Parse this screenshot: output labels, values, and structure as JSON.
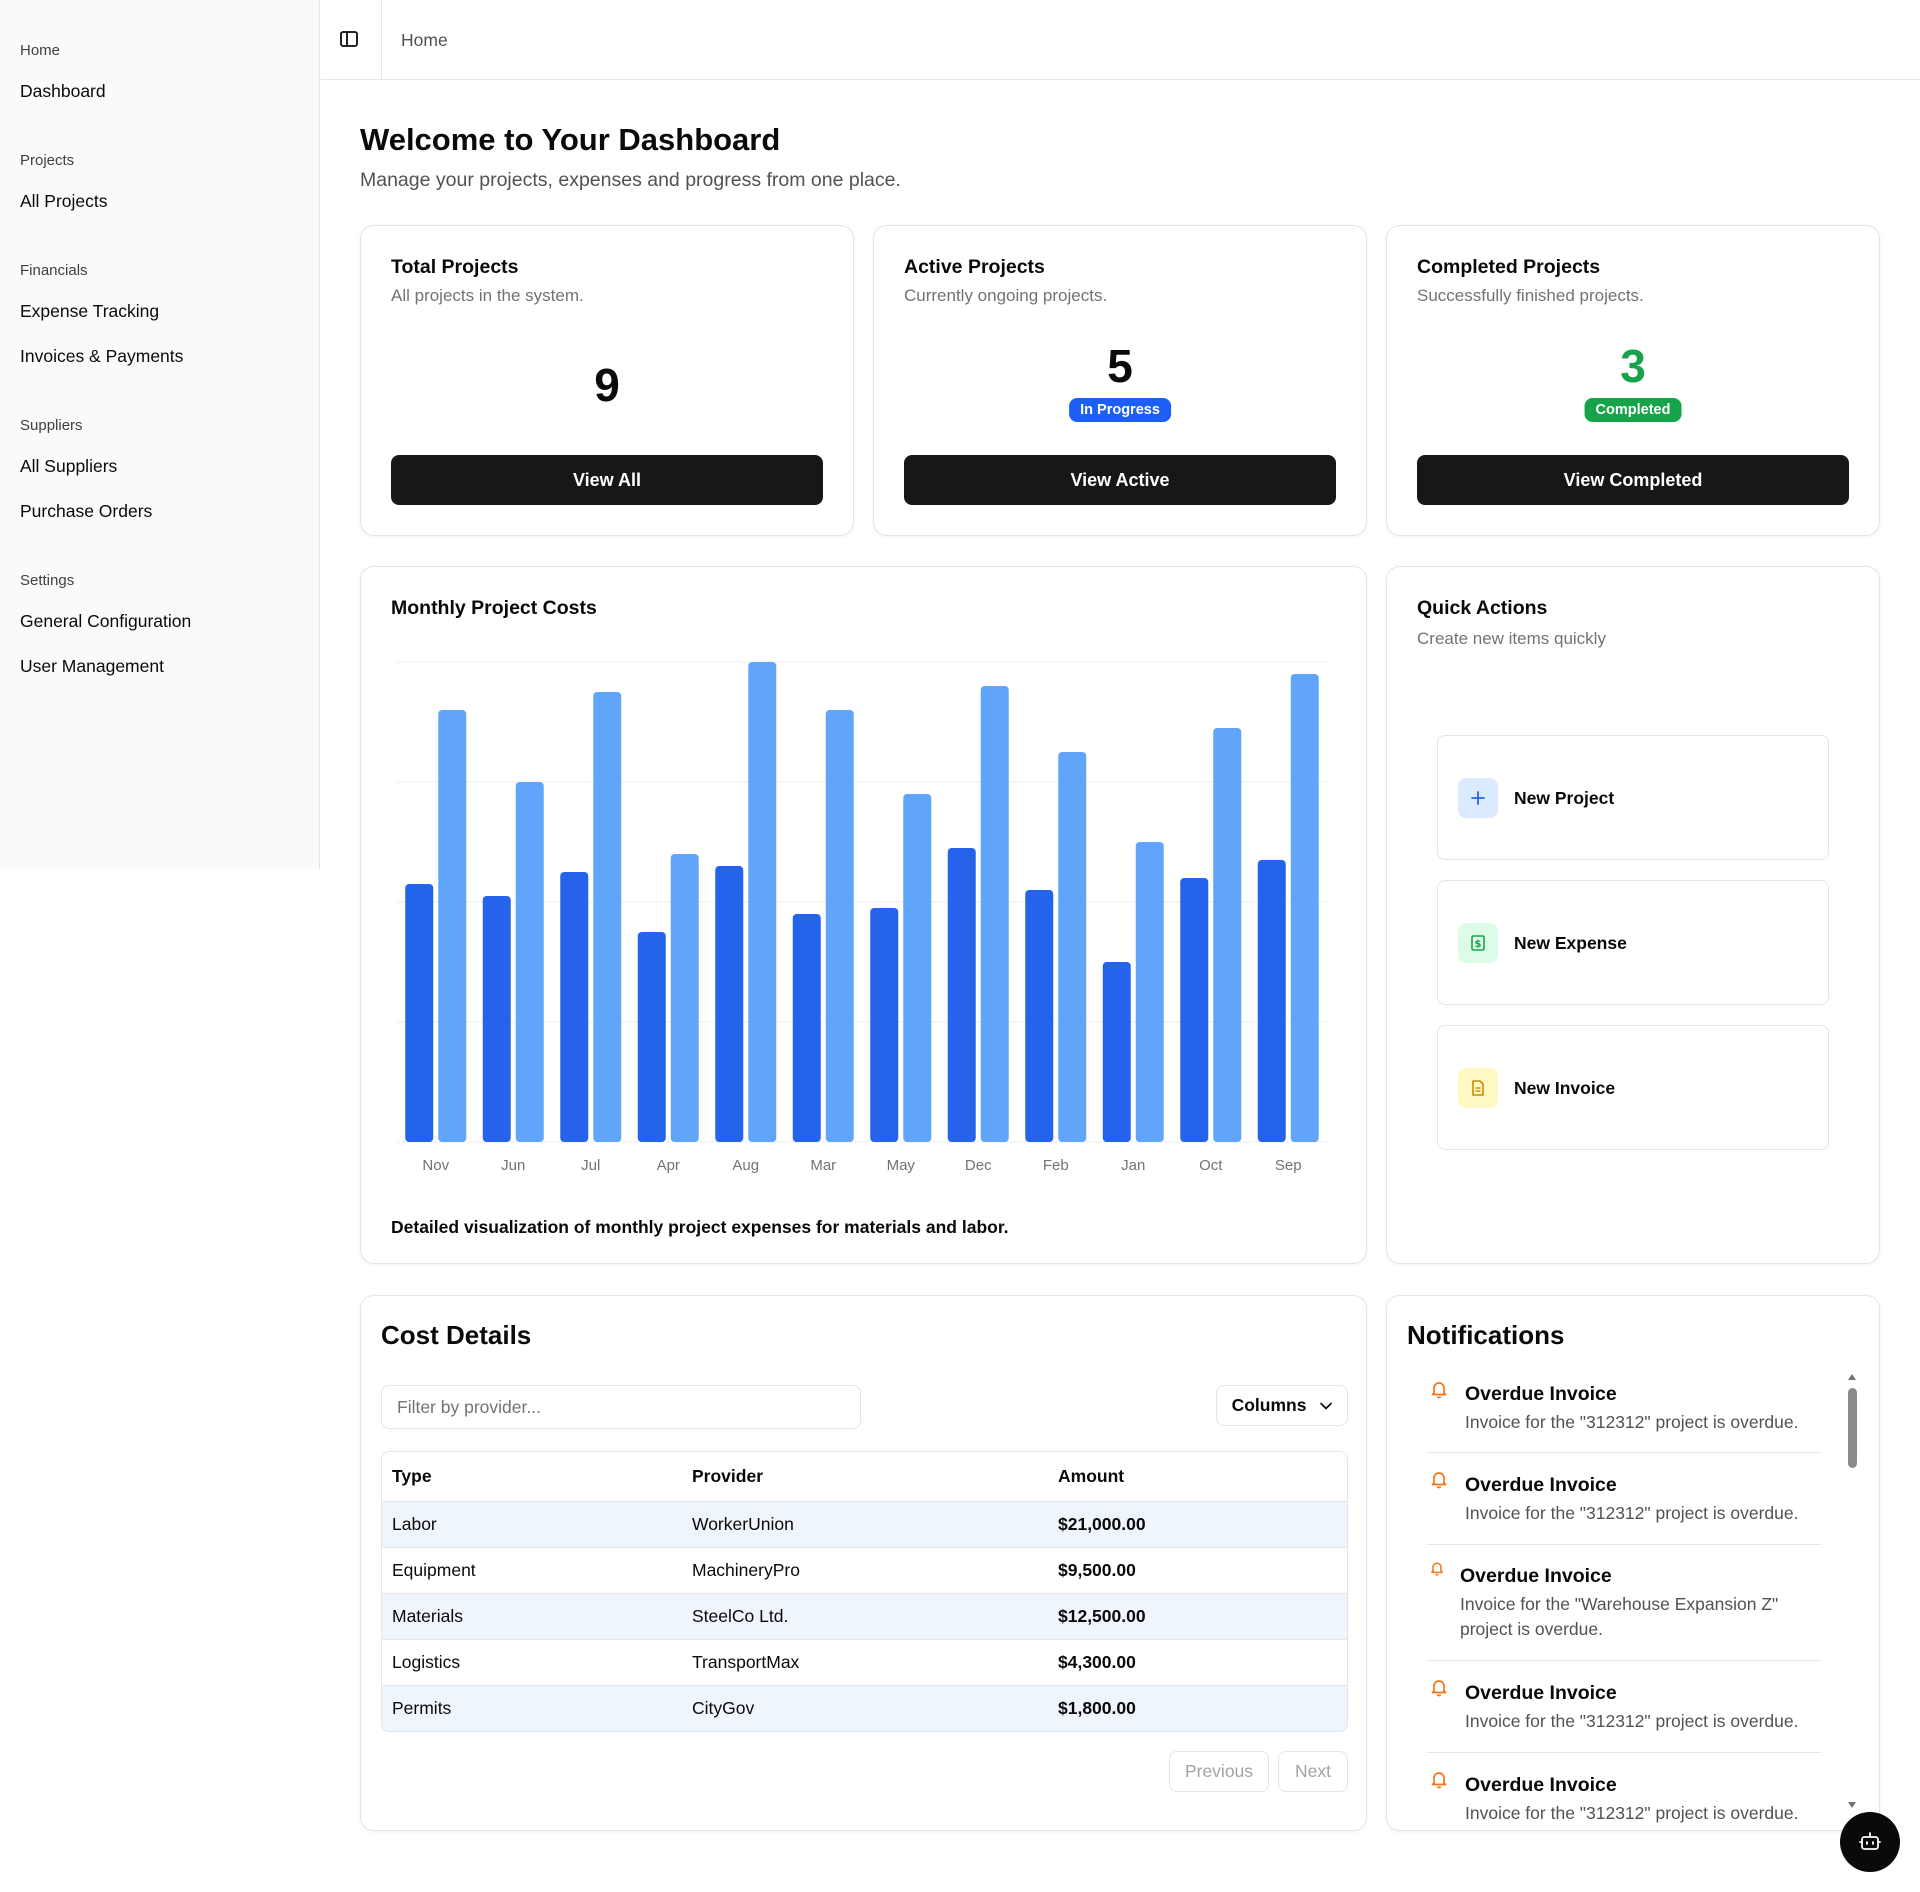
{
  "sidebar": {
    "groups": [
      {
        "label": "Home",
        "items": [
          "Dashboard"
        ]
      },
      {
        "label": "Projects",
        "items": [
          "All Projects"
        ]
      },
      {
        "label": "Financials",
        "items": [
          "Expense Tracking",
          "Invoices & Payments"
        ]
      },
      {
        "label": "Suppliers",
        "items": [
          "All Suppliers",
          "Purchase Orders"
        ]
      },
      {
        "label": "Settings",
        "items": [
          "General Configuration",
          "User Management"
        ]
      }
    ]
  },
  "header": {
    "breadcrumb": "Home",
    "toggle_icon": "sidebar-toggle-icon"
  },
  "page": {
    "title": "Welcome to Your Dashboard",
    "subtitle": "Manage your projects, expenses and progress from one place."
  },
  "stats": [
    {
      "title": "Total Projects",
      "desc": "All projects in the system.",
      "value": "9",
      "badge": "",
      "button": "View All",
      "value_color": "#0a0a0a"
    },
    {
      "title": "Active Projects",
      "desc": "Currently ongoing projects.",
      "value": "5",
      "badge": "In Progress",
      "badge_color": "#1d5ff5",
      "button": "View Active",
      "value_color": "#0a0a0a"
    },
    {
      "title": "Completed Projects",
      "desc": "Successfully finished projects.",
      "value": "3",
      "badge": "Completed",
      "badge_color": "#16a34a",
      "button": "View Completed",
      "value_color": "#16a34a"
    }
  ],
  "chart_card": {
    "title": "Monthly Project Costs",
    "caption": "Detailed visualization of monthly project expenses for materials and labor."
  },
  "chart_data": {
    "type": "bar",
    "categories": [
      "Nov",
      "Jun",
      "Jul",
      "Apr",
      "Aug",
      "Mar",
      "May",
      "Dec",
      "Feb",
      "Jan",
      "Oct",
      "Sep"
    ],
    "series": [
      {
        "values": [
          43,
          41,
          45,
          35,
          46,
          38,
          39,
          49,
          42,
          30,
          44,
          47
        ],
        "color": "#2563eb"
      },
      {
        "values": [
          72,
          60,
          75,
          48,
          80,
          72,
          58,
          76,
          65,
          50,
          69,
          78
        ],
        "color": "#60a5fa"
      }
    ],
    "ylim": [
      0,
      80
    ],
    "grid": true,
    "legend": "none"
  },
  "quick_actions": {
    "title": "Quick Actions",
    "desc": "Create new items quickly",
    "items": [
      {
        "label": "New Project",
        "icon": "plus-icon",
        "bg": "#dbeafe",
        "fg": "#2563eb"
      },
      {
        "label": "New Expense",
        "icon": "dollar-icon",
        "bg": "#dcfce7",
        "fg": "#16a34a"
      },
      {
        "label": "New Invoice",
        "icon": "document-icon",
        "bg": "#fef9c3",
        "fg": "#ca8a04"
      }
    ]
  },
  "cost_details": {
    "title": "Cost Details",
    "filter_placeholder": "Filter by provider...",
    "columns_button": "Columns",
    "headers": [
      "Type",
      "Provider",
      "Amount"
    ],
    "rows": [
      [
        "Labor",
        "WorkerUnion",
        "$21,000.00"
      ],
      [
        "Equipment",
        "MachineryPro",
        "$9,500.00"
      ],
      [
        "Materials",
        "SteelCo Ltd.",
        "$12,500.00"
      ],
      [
        "Logistics",
        "TransportMax",
        "$4,300.00"
      ],
      [
        "Permits",
        "CityGov",
        "$1,800.00"
      ]
    ],
    "prev": "Previous",
    "next": "Next"
  },
  "notifications": {
    "title": "Notifications",
    "items": [
      {
        "title": "Overdue Invoice",
        "text": "Invoice for the \"312312\" project is overdue."
      },
      {
        "title": "Overdue Invoice",
        "text": "Invoice for the \"312312\" project is overdue."
      },
      {
        "title": "Overdue Invoice",
        "text": "Invoice for the \"Warehouse Expansion Z\" project is overdue."
      },
      {
        "title": "Overdue Invoice",
        "text": "Invoice for the \"312312\" project is overdue."
      },
      {
        "title": "Overdue Invoice",
        "text": "Invoice for the \"312312\" project is overdue."
      }
    ]
  },
  "colors": {
    "accent_dark": "#171717",
    "bell": "#f97316"
  }
}
